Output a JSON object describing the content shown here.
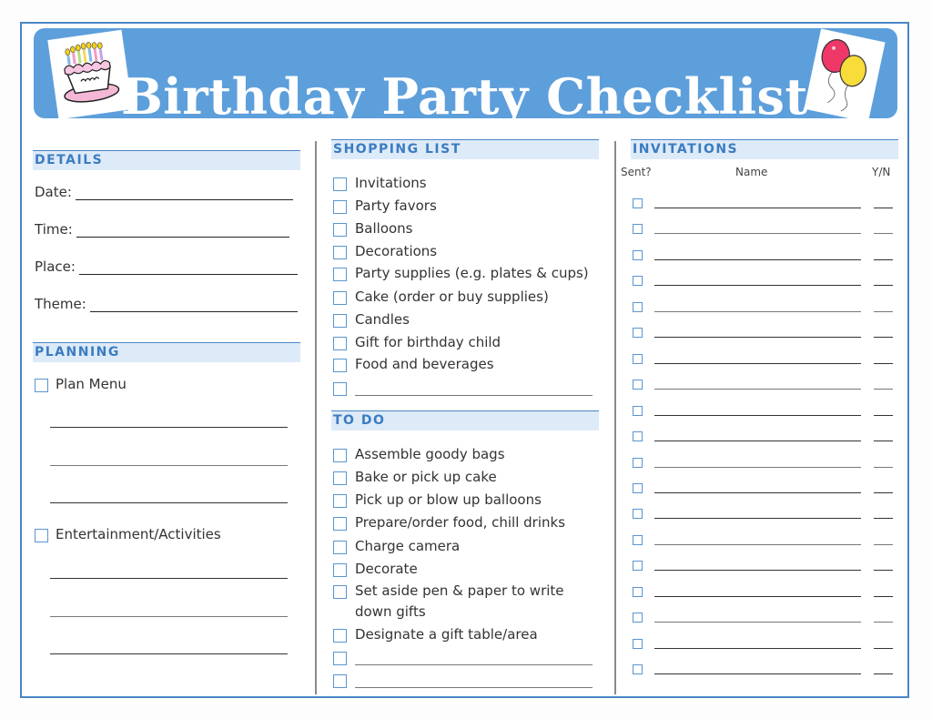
{
  "title": "Birthday Party Checklist",
  "images": {
    "left": "birthday-cake-clipart",
    "right": "balloons-clipart"
  },
  "details": {
    "header": "DETAILS",
    "fields": [
      {
        "label": "Date:",
        "value": ""
      },
      {
        "label": "Time:",
        "value": ""
      },
      {
        "label": "Place:",
        "value": ""
      },
      {
        "label": "Theme:",
        "value": ""
      }
    ]
  },
  "planning": {
    "header": "PLANNING",
    "items": [
      {
        "label": "Plan Menu",
        "checked": false,
        "blank_lines": 3
      },
      {
        "label": "Entertainment/Activities",
        "checked": false,
        "blank_lines": 3
      }
    ]
  },
  "shopping": {
    "header": "SHOPPING LIST",
    "items": [
      {
        "label": "Invitations",
        "checked": false
      },
      {
        "label": "Party favors",
        "checked": false
      },
      {
        "label": "Balloons",
        "checked": false
      },
      {
        "label": "Decorations",
        "checked": false
      },
      {
        "label": "Party supplies (e.g. plates & cups)",
        "checked": false
      },
      {
        "label": "Cake (order or buy supplies)",
        "checked": false
      },
      {
        "label": "Candles",
        "checked": false
      },
      {
        "label": "Gift for birthday child",
        "checked": false
      },
      {
        "label": "Food and beverages",
        "checked": false
      },
      {
        "label": "",
        "checked": false
      }
    ]
  },
  "todo": {
    "header": "TO DO",
    "items": [
      {
        "label": "Assemble goody bags",
        "checked": false
      },
      {
        "label": "Bake or pick up cake",
        "checked": false
      },
      {
        "label": "Pick up  or blow up balloons",
        "checked": false
      },
      {
        "label": "Prepare/order food, chill drinks",
        "checked": false
      },
      {
        "label": "Charge camera",
        "checked": false
      },
      {
        "label": "Decorate",
        "checked": false
      },
      {
        "label": "Set aside pen & paper to write",
        "label2": "down gifts",
        "checked": false
      },
      {
        "label": "Designate a gift table/area",
        "checked": false
      },
      {
        "label": "",
        "checked": false
      },
      {
        "label": "",
        "checked": false
      }
    ]
  },
  "invitations": {
    "header": "INVITATIONS",
    "columns": {
      "sent": "Sent?",
      "name": "Name",
      "yn": "Y/N"
    },
    "row_count": 19
  },
  "colors": {
    "accent": "#5d9fdb",
    "header_text": "#3b7cc0",
    "header_bg": "#ddeaf8",
    "border": "#4a86c5"
  }
}
